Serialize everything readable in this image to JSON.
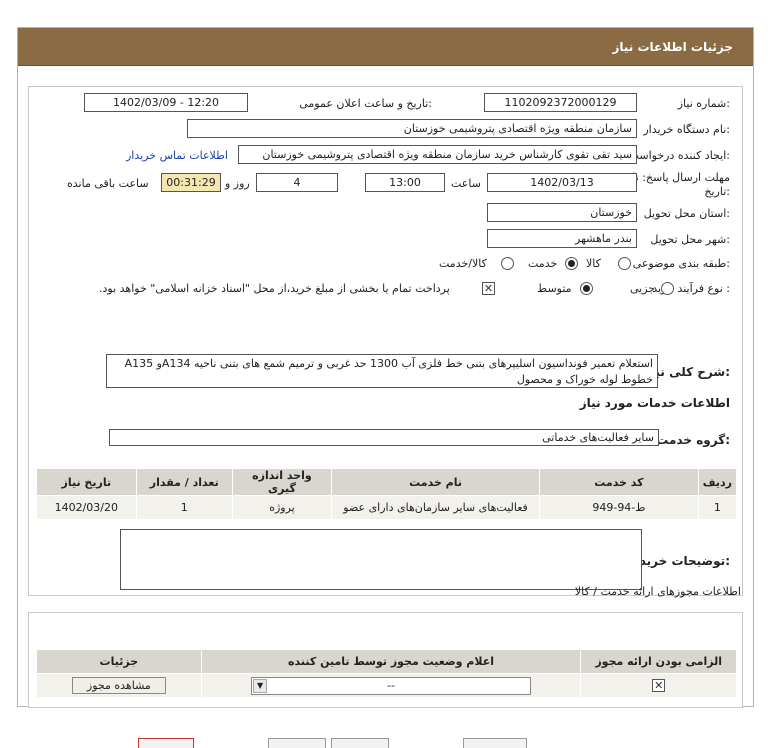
{
  "header": {
    "title": "جزئیات اطلاعات نیاز"
  },
  "labels": {
    "need_number": "شماره نیاز:",
    "announce_datetime": "تاریخ و ساعت اعلان عمومی:",
    "buyer_org": "نام دستگاه خریدار:",
    "requester": "ایجاد کننده درخواست:",
    "deadline": "مهلت ارسال پاسخ: تا",
    "deadline_date": "تاریخ:",
    "time": "ساعت",
    "days_and": "روز و",
    "remaining": "ساعت باقی مانده",
    "province": "استان محل تحویل:",
    "city": "شهر محل تحویل:",
    "category": "طبقه بندی موضوعی:",
    "purchase_type": "نوع فرآیند خرید :",
    "general_desc": "شرح کلی نیاز:",
    "services_info": "اطلاعات خدمات مورد نیاز",
    "service_group": "گروه خدمت:",
    "buyer_notes": "توضیحات خریدار:",
    "permits_info": "اطلاعات مجوزهای ارائه خدمت / کالا"
  },
  "values": {
    "need_number": "1102092372000129",
    "announce_datetime": "1402/03/09 - 12:20",
    "buyer_org": "سازمان منطقه ویژه اقتصادی پتروشیمی خوزستان",
    "requester": "سید تقی تقوی کارشناس خرید سازمان منطقه ویژه اقتصادی پتروشیمی خوزستان",
    "contact_link": "اطلاعات تماس خریدار",
    "deadline_date": "1402/03/13",
    "deadline_time": "13:00",
    "days": "4",
    "remaining_time": "00:31:29",
    "province": "خوزستان",
    "city": "بندر ماهشهر",
    "general_desc": "استعلام تعمیر فونداسیون اسلیپرهای بتنی خط فلزی آب 1300 حد غربی و ترمیم شمع های بتنی ناحیه A134و A135 خطوط لوله خوراک و محصول",
    "service_group": "سایر فعالیت‌های خدماتی"
  },
  "category_options": [
    {
      "label": "کالا",
      "selected": false
    },
    {
      "label": "خدمت",
      "selected": true
    },
    {
      "label": "کالا/خدمت",
      "selected": false
    }
  ],
  "purchase_options": [
    {
      "label": "جزیی",
      "selected": false
    },
    {
      "label": "متوسط",
      "selected": true
    }
  ],
  "purchase_note": "پرداخت تمام یا بخشی از مبلغ خرید،از محل \"اسناد خزانه اسلامی\" خواهد بود.",
  "services_table": {
    "headers": [
      "ردیف",
      "کد خدمت",
      "نام خدمت",
      "واحد اندازه گیری",
      "تعداد / مقدار",
      "تاریخ نیاز"
    ],
    "rows": [
      [
        "1",
        "ط-94-949",
        "فعالیت‌های سایر سازمان‌های دارای عضو",
        "پروژه",
        "1",
        "1402/03/20"
      ]
    ]
  },
  "permits_table": {
    "headers": [
      "الزامی بودن ارائه مجوز",
      "اعلام وضعیت مجوز توسط تامین کننده",
      "جزئیات"
    ],
    "select_value": "--",
    "view_button": "مشاهده مجوز"
  },
  "colors": {
    "header_bg": "#8b6b43",
    "timer_bg": "#f3e6b0",
    "link": "#1b3fa8"
  }
}
